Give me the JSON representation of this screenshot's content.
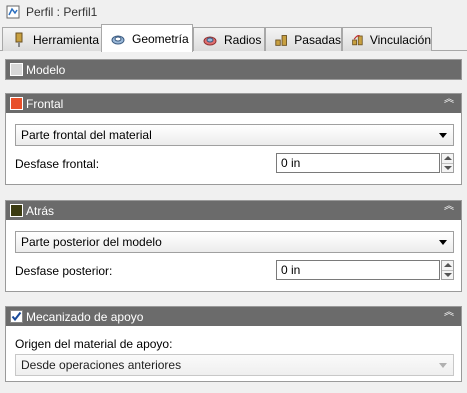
{
  "window": {
    "title": "Perfil : Perfil1"
  },
  "tabs": [
    {
      "label": "Herramienta",
      "icon": "tool-icon"
    },
    {
      "label": "Geometría",
      "icon": "geometry-icon",
      "active": true
    },
    {
      "label": "Radios",
      "icon": "radii-icon"
    },
    {
      "label": "Pasadas",
      "icon": "passes-icon"
    },
    {
      "label": "Vinculación",
      "icon": "linking-icon"
    }
  ],
  "sections": {
    "modelo": {
      "label": "Modelo",
      "checked": false
    },
    "frontal": {
      "label": "Frontal",
      "color": "#e8502a",
      "dropdown_value": "Parte frontal del material",
      "offset_label": "Desfase frontal:",
      "offset_value": "0 in"
    },
    "atras": {
      "label": "Atrás",
      "color": "#6b6b20",
      "dropdown_value": "Parte posterior del modelo",
      "offset_label": "Desfase posterior:",
      "offset_value": "0 in"
    },
    "mecanizado": {
      "label": "Mecanizado de apoyo",
      "checked": true,
      "source_label": "Origen del material de apoyo:",
      "source_value": "Desde operaciones anteriores"
    }
  },
  "colors": {
    "section_header": "#6b6b6b",
    "frontal_swatch": "#e8502a",
    "atras_swatch": "#3a3a10"
  }
}
